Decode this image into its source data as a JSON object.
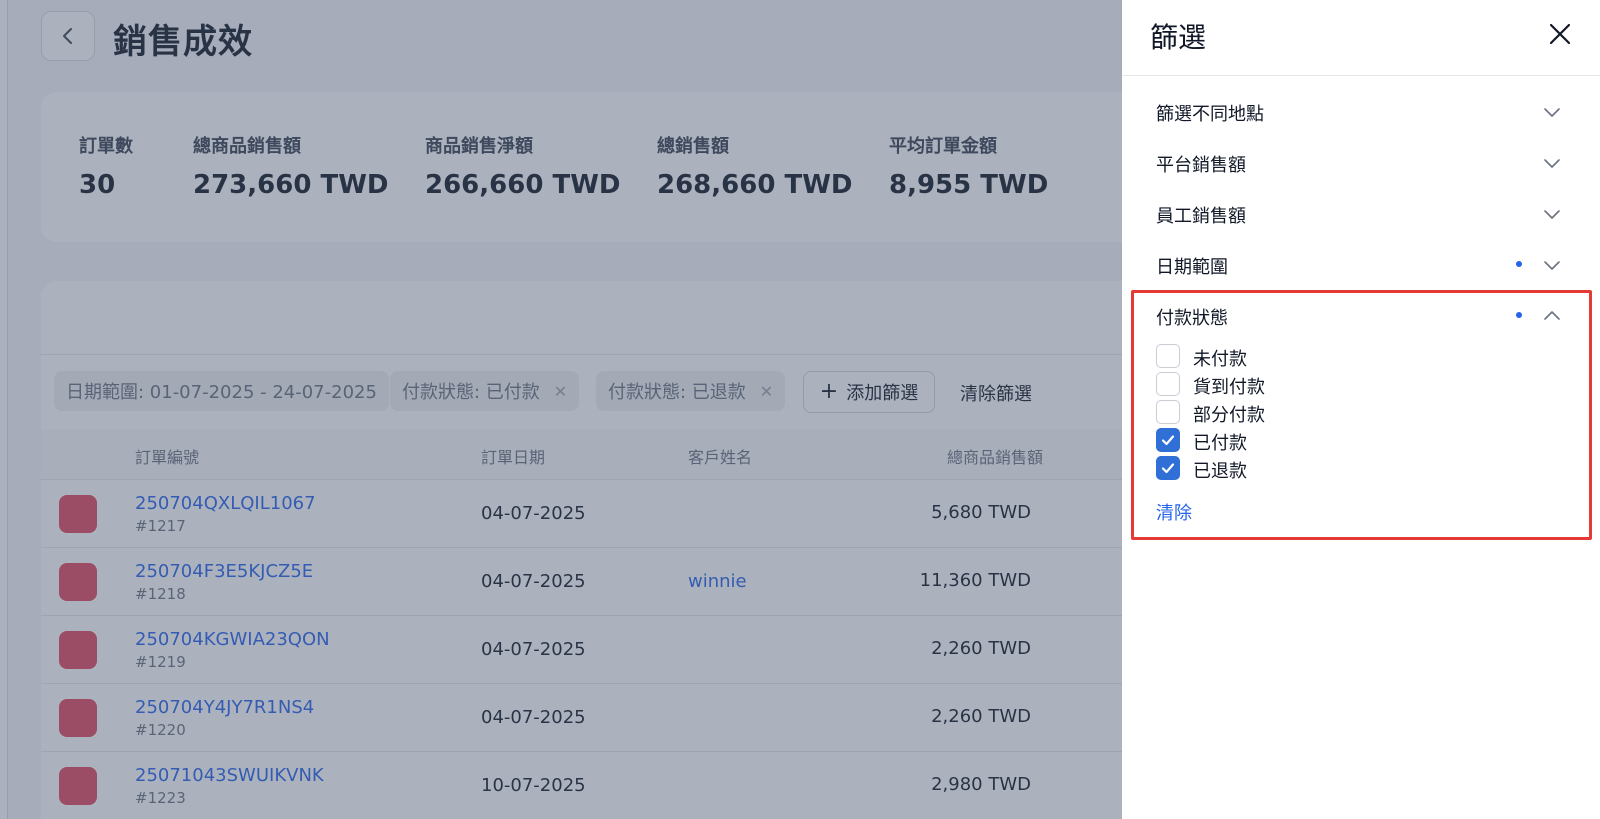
{
  "page": {
    "title": "銷售成效"
  },
  "stats": [
    {
      "label": "訂單數",
      "value": "30"
    },
    {
      "label": "總商品銷售額",
      "value": "273,660 TWD"
    },
    {
      "label": "商品銷售淨額",
      "value": "266,660 TWD"
    },
    {
      "label": "總銷售額",
      "value": "268,660 TWD"
    },
    {
      "label": "平均訂單金額",
      "value": "8,955 TWD"
    }
  ],
  "active_filters": [
    {
      "label": "日期範圍: 01-07-2025 - 24-07-2025"
    },
    {
      "label": "付款狀態: 已付款"
    },
    {
      "label": "付款狀態: 已退款"
    }
  ],
  "filter_actions": {
    "add": "添加篩選",
    "clear": "清除篩選"
  },
  "table": {
    "headers": [
      "訂單編號",
      "訂單日期",
      "客戶姓名",
      "總商品銷售額"
    ],
    "rows": [
      {
        "order_no": "250704QXLQIL1067",
        "order_id": "#1217",
        "date": "04-07-2025",
        "customer": "",
        "amount": "5,680 TWD"
      },
      {
        "order_no": "250704F3E5KJCZ5E",
        "order_id": "#1218",
        "date": "04-07-2025",
        "customer": "winnie",
        "amount": "11,360 TWD"
      },
      {
        "order_no": "250704KGWIA23QON",
        "order_id": "#1219",
        "date": "04-07-2025",
        "customer": "",
        "amount": "2,260 TWD"
      },
      {
        "order_no": "250704Y4JY7R1NS4",
        "order_id": "#1220",
        "date": "04-07-2025",
        "customer": "",
        "amount": "2,260 TWD"
      },
      {
        "order_no": "25071043SWUIKVNK",
        "order_id": "#1223",
        "date": "10-07-2025",
        "customer": "",
        "amount": "2,980 TWD"
      }
    ]
  },
  "drawer": {
    "title": "篩選",
    "sections": [
      {
        "label": "篩選不同地點",
        "active": false,
        "expanded": false
      },
      {
        "label": "平台銷售額",
        "active": false,
        "expanded": false
      },
      {
        "label": "員工銷售額",
        "active": false,
        "expanded": false
      },
      {
        "label": "日期範圍",
        "active": true,
        "expanded": false
      },
      {
        "label": "付款狀態",
        "active": true,
        "expanded": true
      }
    ],
    "payment_options": [
      {
        "label": "未付款",
        "checked": false
      },
      {
        "label": "貨到付款",
        "checked": false
      },
      {
        "label": "部分付款",
        "checked": false
      },
      {
        "label": "已付款",
        "checked": true
      },
      {
        "label": "已退款",
        "checked": true
      }
    ],
    "clear_label": "清除"
  },
  "colors": {
    "accent": "#2f6fd6",
    "link": "#2563eb",
    "highlight": "#e53935",
    "order_icon": "#e0485f"
  }
}
